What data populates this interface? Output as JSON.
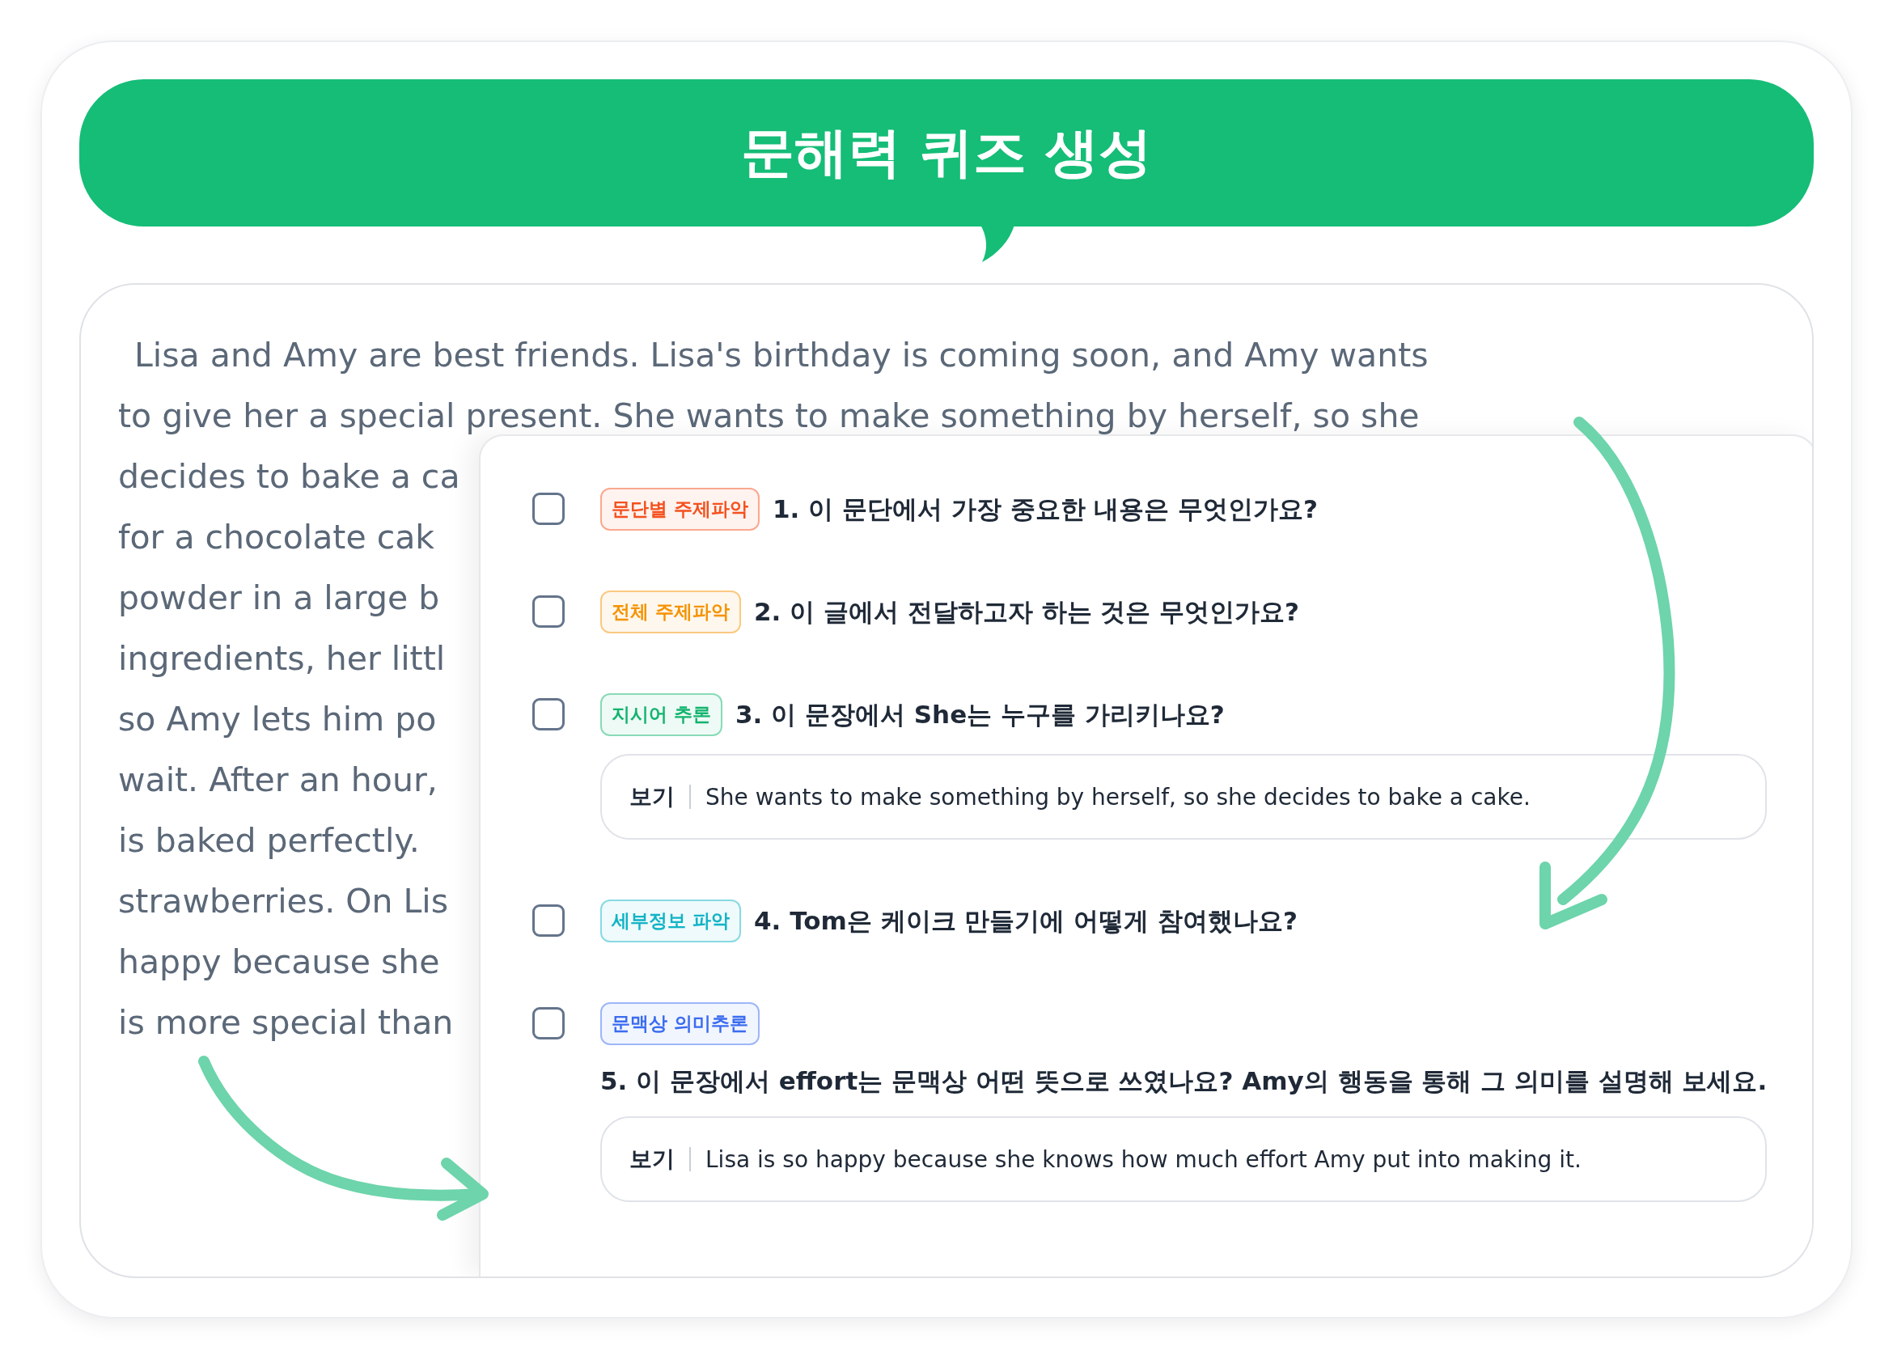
{
  "title": "문해력 퀴즈 생성",
  "passage": {
    "lines": [
      "Lisa and Amy are best friends. Lisa's birthday is coming soon, and Amy wants",
      "to give her a special present. She wants to make something by herself, so she",
      "decides to bake a ca",
      "for a chocolate cak",
      "powder in a large b",
      "ingredients, her littl",
      "so Amy lets him po",
      "wait. After an hour,",
      "is baked perfectly.",
      "strawberries. On Lis",
      "happy because she",
      "is more special than"
    ]
  },
  "questions": [
    {
      "kind": "inline",
      "checked": false,
      "tag": "문단별 주제파악",
      "color": "#f4511e",
      "question": "1. 이 문단에서 가장 중요한 내용은 무엇인가요?"
    },
    {
      "kind": "inline",
      "checked": false,
      "tag": "전체 주제파악",
      "color": "#f59300",
      "question": "2. 이 글에서 전달하고자 하는 것은 무엇인가요?"
    },
    {
      "kind": "inline",
      "checked": false,
      "tag": "지시어 추론",
      "color": "#13b46e",
      "question": "3. 이 문장에서 She는 누구를 가리키나요?",
      "example": {
        "label": "보기",
        "text": "She wants to make something by herself, so she decides to bake a cake."
      }
    },
    {
      "kind": "inline",
      "checked": false,
      "tag": "세부정보 파악",
      "color": "#12b3c6",
      "question": "4. Tom은 케이크 만들기에 어떻게 참여했나요?"
    },
    {
      "kind": "stacked",
      "checked": false,
      "tag": "문맥상 의미추론",
      "color": "#3b6cf0",
      "question": "5. 이 문장에서 effort는 문맥상 어떤 뜻으로 쓰였나요? Amy의 행동을 통해 그 의미를 설명해 보세요.",
      "example": {
        "label": "보기",
        "text": "Lisa is so happy because she knows how much effort Amy put into making it."
      }
    }
  ]
}
